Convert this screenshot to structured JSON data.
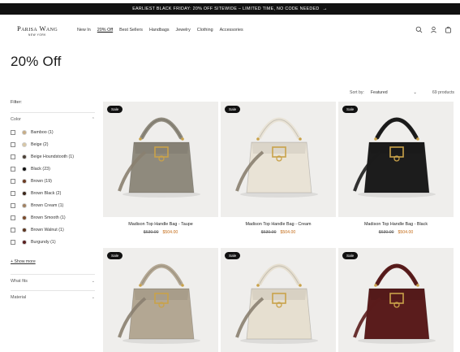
{
  "promo": {
    "text": "EARLIEST BLACK FRIDAY: 20% OFF SITEWIDE – LIMITED TIME, NO CODE NEEDED",
    "arrow": "→"
  },
  "brand": {
    "name": "Parisa Wang",
    "tagline": "NEW YORK"
  },
  "nav": [
    "New In",
    "20% Off",
    "Best Sellers",
    "Handbags",
    "Jewelry",
    "Clothing",
    "Accessories"
  ],
  "nav_active": "20% Off",
  "header_icons": [
    "search-icon",
    "account-icon",
    "cart-icon"
  ],
  "page": {
    "title": "20% Off"
  },
  "sort": {
    "label": "Sort by:",
    "value": "Featured",
    "count": "69 products"
  },
  "filters": {
    "label": "Filter:",
    "color": {
      "heading": "Color",
      "options": [
        {
          "label": "Bamboo (1)",
          "swatch": "#c7ad86"
        },
        {
          "label": "Beige (2)",
          "swatch": "#d8c7a6"
        },
        {
          "label": "Beige Houndstooth (1)",
          "swatch": "#4b4036"
        },
        {
          "label": "Black (23)",
          "swatch": "#111111"
        },
        {
          "label": "Brown (19)",
          "swatch": "#6b3a22"
        },
        {
          "label": "Brown Black (2)",
          "swatch": "#3a2418"
        },
        {
          "label": "Brown Cream (1)",
          "swatch": "#a08060"
        },
        {
          "label": "Brown Smooth (1)",
          "swatch": "#7a4a2a"
        },
        {
          "label": "Brown Walnut (1)",
          "swatch": "#5c3520"
        },
        {
          "label": "Burgundy (1)",
          "swatch": "#5a1e1e"
        }
      ],
      "show_more": "+ Show more"
    },
    "what_fits": "What fits",
    "material": "Material"
  },
  "products": [
    {
      "name": "Madison Top Handle Bag - Taupe",
      "old_price": "$630.00",
      "price": "$504.00",
      "badge": "Sale",
      "color": "#8f8a7d"
    },
    {
      "name": "Madison Top Handle Bag - Cream",
      "old_price": "$630.00",
      "price": "$504.00",
      "badge": "Sale",
      "color": "#e9e3d6"
    },
    {
      "name": "Madison Top Handle Bag - Black",
      "old_price": "$630.00",
      "price": "$504.00",
      "badge": "Sale",
      "color": "#1c1c1c"
    },
    {
      "badge": "Sale",
      "color": "#b3a793"
    },
    {
      "badge": "Sale",
      "color": "#e6dfd0"
    },
    {
      "badge": "Sale",
      "color": "#5a1c1c"
    }
  ],
  "colors": {
    "accent_price": "#c46b16",
    "promo_bg": "#111111",
    "card_bg": "#efeeec",
    "gold": "#c9a24a"
  }
}
